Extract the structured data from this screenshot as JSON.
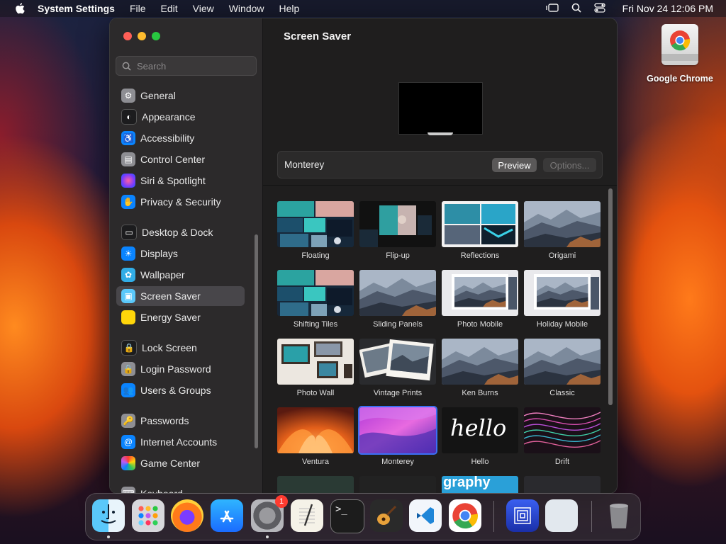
{
  "menubar": {
    "app_name": "System Settings",
    "menus": [
      "File",
      "Edit",
      "View",
      "Window",
      "Help"
    ],
    "clock": "Fri Nov 24  12:06 PM"
  },
  "desktop": {
    "icon_label": "Google Chrome"
  },
  "sidebar": {
    "search_placeholder": "Search",
    "items": [
      {
        "label": "General",
        "icon": "gear-icon",
        "color": "#8e8e93"
      },
      {
        "label": "Appearance",
        "icon": "appearance-icon",
        "color": "#1c1c1e"
      },
      {
        "label": "Accessibility",
        "icon": "accessibility-icon",
        "color": "#0a84ff"
      },
      {
        "label": "Control Center",
        "icon": "control-center-icon",
        "color": "#8e8e93"
      },
      {
        "label": "Siri & Spotlight",
        "icon": "siri-icon",
        "color": "#bf5af2"
      },
      {
        "label": "Privacy & Security",
        "icon": "hand-icon",
        "color": "#0a84ff"
      },
      {
        "label": "Desktop & Dock",
        "icon": "dock-icon",
        "color": "#1c1c1e"
      },
      {
        "label": "Displays",
        "icon": "sun-icon",
        "color": "#0a84ff"
      },
      {
        "label": "Wallpaper",
        "icon": "flower-icon",
        "color": "#32ade6"
      },
      {
        "label": "Screen Saver",
        "icon": "screensaver-icon",
        "color": "#5ac8fa"
      },
      {
        "label": "Energy Saver",
        "icon": "bulb-icon",
        "color": "#ffd60a"
      },
      {
        "label": "Lock Screen",
        "icon": "lock-icon",
        "color": "#1c1c1e"
      },
      {
        "label": "Login Password",
        "icon": "lock-icon",
        "color": "#8e8e93"
      },
      {
        "label": "Users & Groups",
        "icon": "users-icon",
        "color": "#0a84ff"
      },
      {
        "label": "Passwords",
        "icon": "key-icon",
        "color": "#8e8e93"
      },
      {
        "label": "Internet Accounts",
        "icon": "at-icon",
        "color": "#0a84ff"
      },
      {
        "label": "Game Center",
        "icon": "game-center-icon",
        "color": "#ffffff"
      },
      {
        "label": "Keyboard",
        "icon": "keyboard-icon",
        "color": "#8e8e93"
      }
    ],
    "selected": "Screen Saver"
  },
  "content": {
    "title": "Screen Saver",
    "current_saver": "Monterey",
    "preview_button": "Preview",
    "options_button": "Options...",
    "savers": [
      {
        "name": "Floating",
        "style": "ocean"
      },
      {
        "name": "Flip-up",
        "style": "ocean-dark"
      },
      {
        "name": "Reflections",
        "style": "ocean-white"
      },
      {
        "name": "Origami",
        "style": "mountain"
      },
      {
        "name": "Shifting Tiles",
        "style": "ocean"
      },
      {
        "name": "Sliding Panels",
        "style": "mountain"
      },
      {
        "name": "Photo Mobile",
        "style": "mountain-white"
      },
      {
        "name": "Holiday Mobile",
        "style": "mountain-white"
      },
      {
        "name": "Photo Wall",
        "style": "wall"
      },
      {
        "name": "Vintage Prints",
        "style": "prints"
      },
      {
        "name": "Ken Burns",
        "style": "mountain"
      },
      {
        "name": "Classic",
        "style": "mountain"
      },
      {
        "name": "Ventura",
        "style": "ventura"
      },
      {
        "name": "Monterey",
        "style": "monterey",
        "selected": true
      },
      {
        "name": "Hello",
        "style": "hello"
      },
      {
        "name": "Drift",
        "style": "drift"
      }
    ],
    "hello_text": "hello",
    "partial_row_text": "graphy"
  },
  "dock": {
    "apps": [
      {
        "name": "Finder",
        "icon": "finder-icon"
      },
      {
        "name": "Launchpad",
        "icon": "launchpad-icon"
      },
      {
        "name": "Firefox",
        "icon": "firefox-icon"
      },
      {
        "name": "App Store",
        "icon": "app-store-icon"
      },
      {
        "name": "System Settings",
        "icon": "settings-icon",
        "badge": "1"
      },
      {
        "name": "TextEdit",
        "icon": "textedit-icon"
      },
      {
        "name": "Terminal",
        "icon": "terminal-icon"
      },
      {
        "name": "GarageBand",
        "icon": "guitar-icon"
      },
      {
        "name": "Visual Studio Code",
        "icon": "vscode-icon"
      },
      {
        "name": "Google Chrome",
        "icon": "chrome-icon"
      },
      {
        "name": "Screen Sharing",
        "icon": "square-icon"
      },
      {
        "name": "Blank",
        "icon": "blank-icon"
      },
      {
        "name": "Trash",
        "icon": "trash-icon"
      }
    ],
    "terminal_prompt": ">_"
  }
}
